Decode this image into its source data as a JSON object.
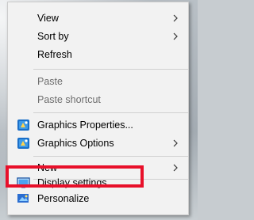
{
  "menu": {
    "items": [
      {
        "label": "View",
        "submenu": true
      },
      {
        "label": "Sort by",
        "submenu": true
      },
      {
        "label": "Refresh"
      },
      {
        "label": "Paste",
        "disabled": true
      },
      {
        "label": "Paste shortcut",
        "disabled": true
      },
      {
        "label": "Graphics Properties...",
        "icon": "intel-graphics-icon"
      },
      {
        "label": "Graphics Options",
        "icon": "intel-graphics-icon",
        "submenu": true
      },
      {
        "label": "New",
        "submenu": true
      },
      {
        "label": "Display settings",
        "icon": "display-monitor-icon"
      },
      {
        "label": "Personalize",
        "icon": "personalize-icon"
      }
    ]
  },
  "colors": {
    "menu_bg": "#f2f2f2",
    "highlight_border": "#e8102a",
    "disabled_text": "#6d6d6d"
  }
}
